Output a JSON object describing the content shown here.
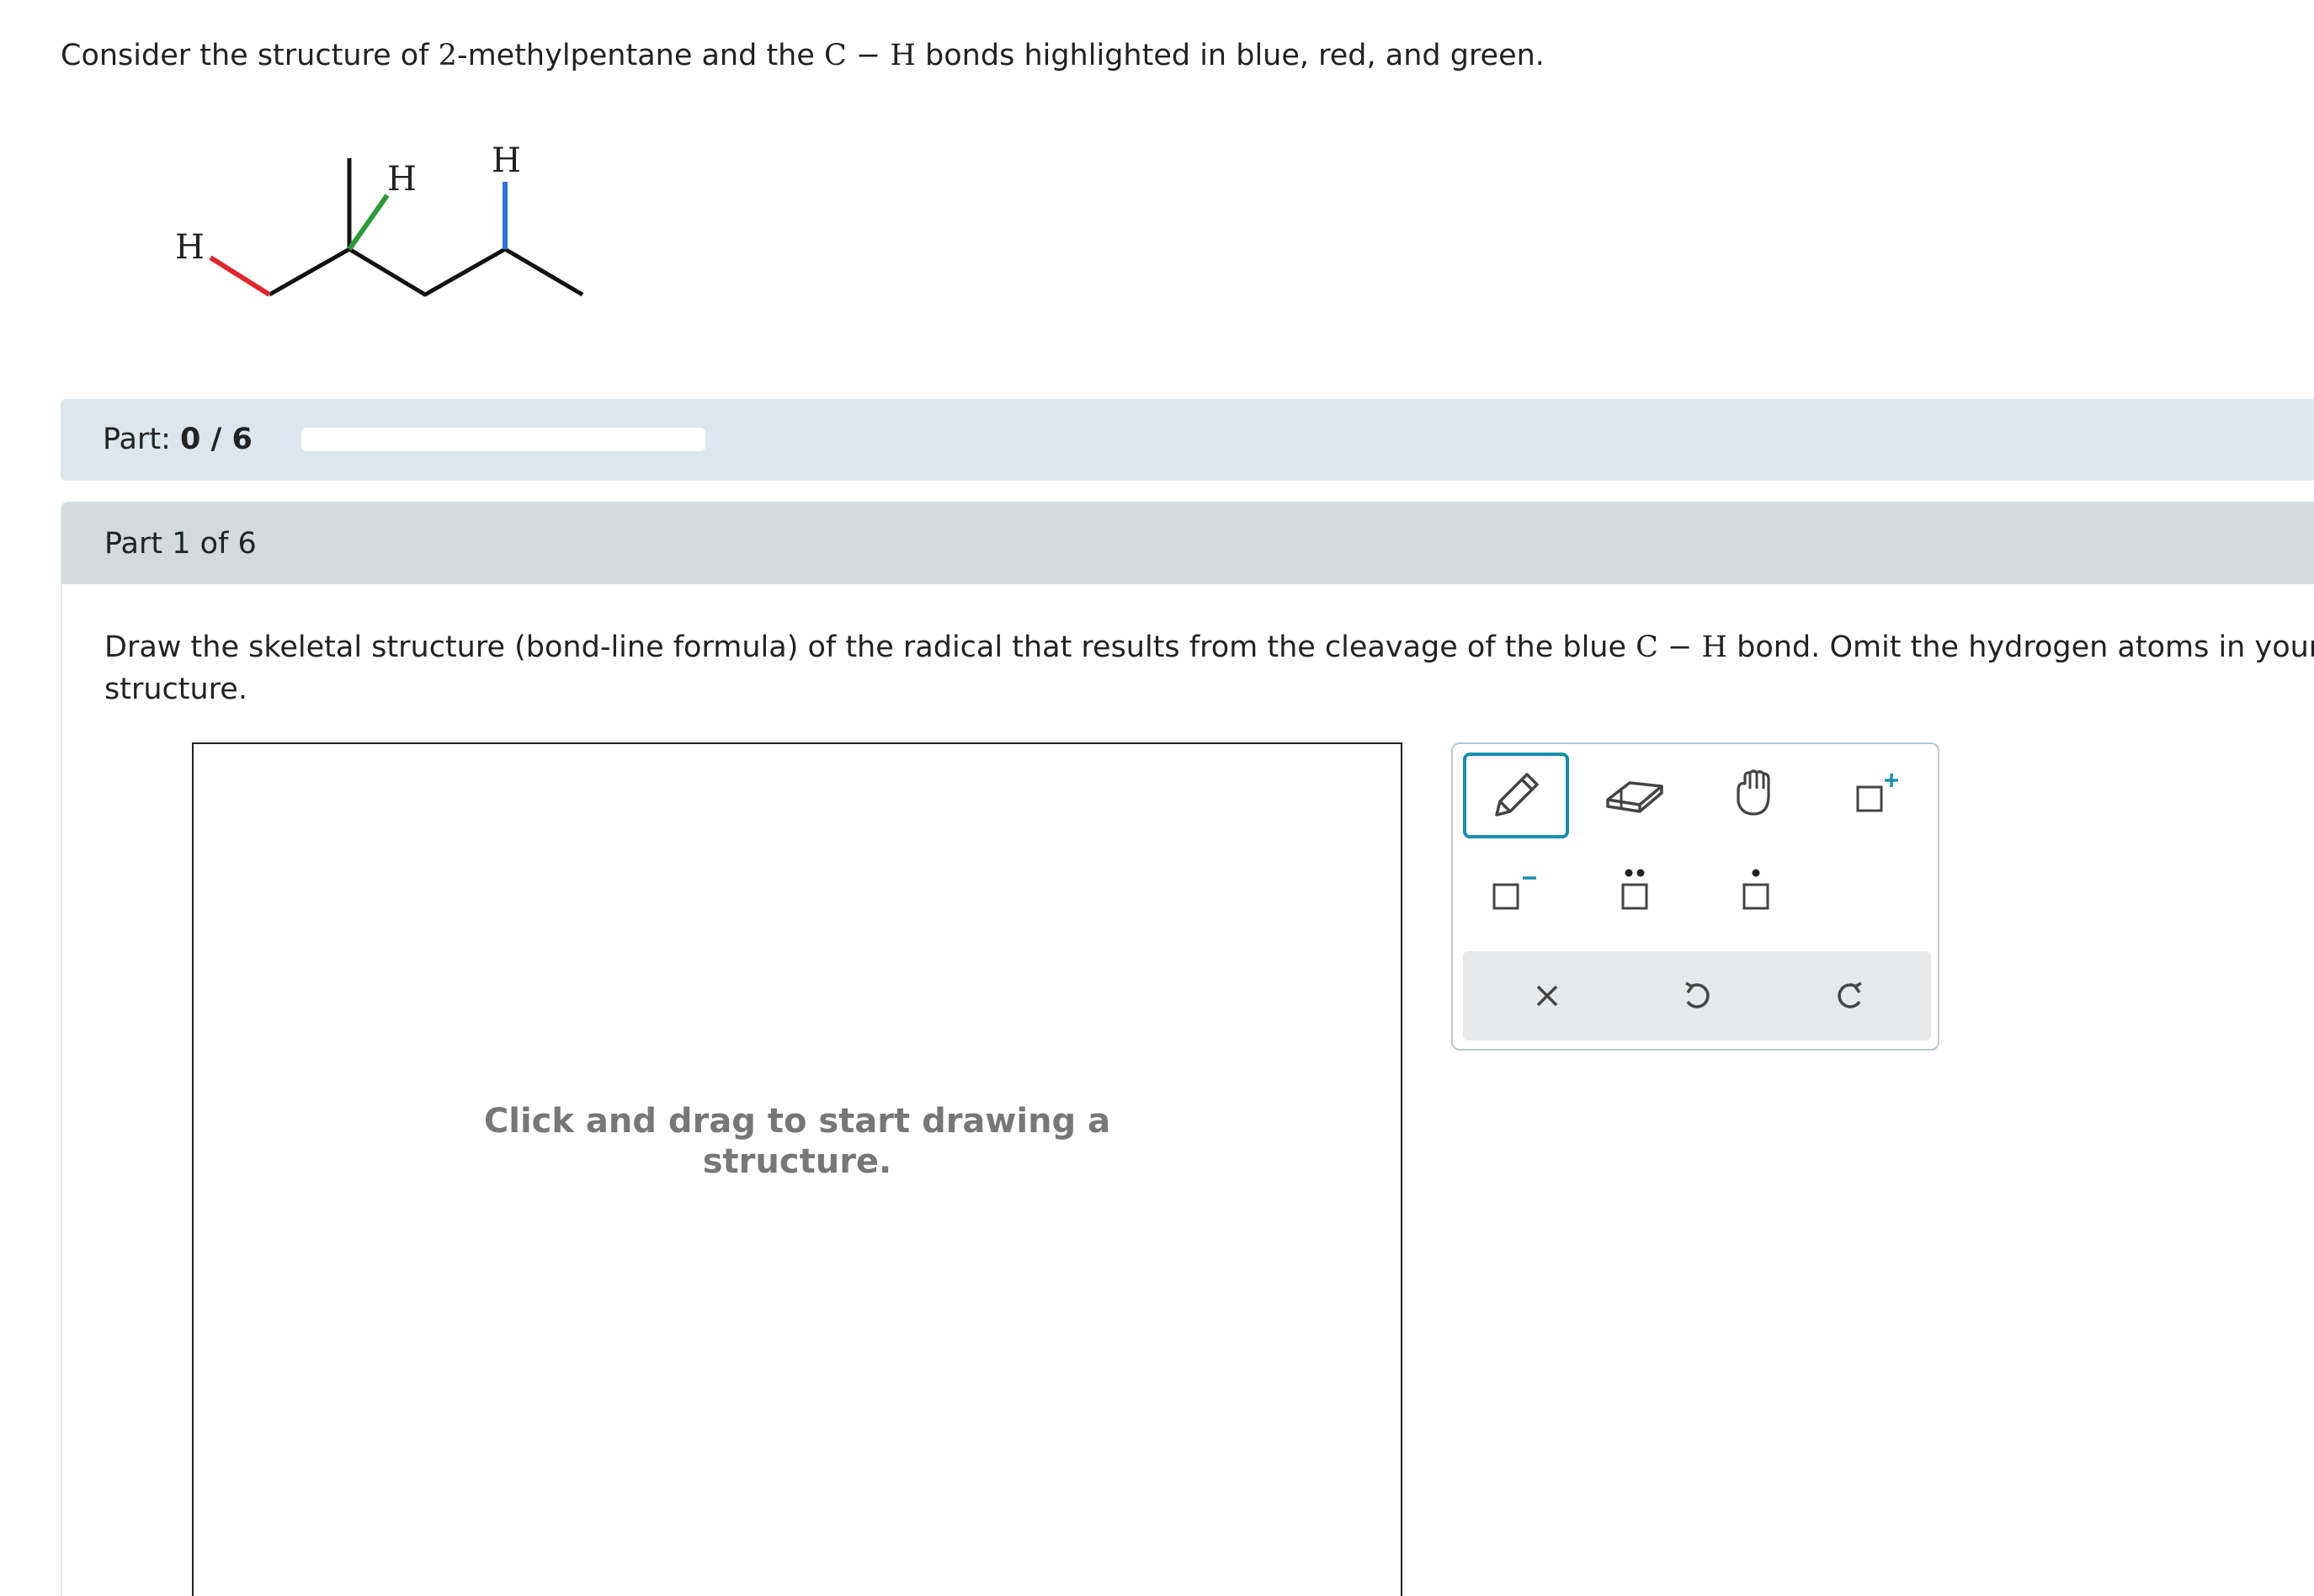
{
  "intro": {
    "text_before": "Consider the structure of ",
    "number": "2",
    "text_middle": "-methylpentane and the ",
    "bond": "C − H",
    "text_after": " bonds highlighted in blue, red, and green."
  },
  "molecule": {
    "h_left": "H",
    "h_green": "H",
    "h_blue": "H",
    "colors": {
      "blue": "#2f6fd6",
      "red": "#e0262f",
      "green": "#2e9a3a"
    }
  },
  "progress": {
    "label": "Part: ",
    "value": "0 / 6",
    "fraction": 0
  },
  "part": {
    "header": "Part 1 of 6",
    "question_before": "Draw the skeletal structure (bond-line formula) of the radical that results from the cleavage of the blue ",
    "question_bond": "C − H",
    "question_after": " bond. Omit the hydrogen atoms in your structure."
  },
  "canvas": {
    "hint_line1": "Click and drag to start drawing a",
    "hint_line2": "structure."
  },
  "toolbar": {
    "tools": [
      "pencil-icon",
      "eraser-icon",
      "hand-icon",
      "positive-charge-icon",
      "negative-charge-icon",
      "lone-pair-icon",
      "radical-icon"
    ],
    "actions": [
      "clear-icon",
      "undo-icon",
      "redo-icon"
    ],
    "accent": "#1a8eac"
  }
}
